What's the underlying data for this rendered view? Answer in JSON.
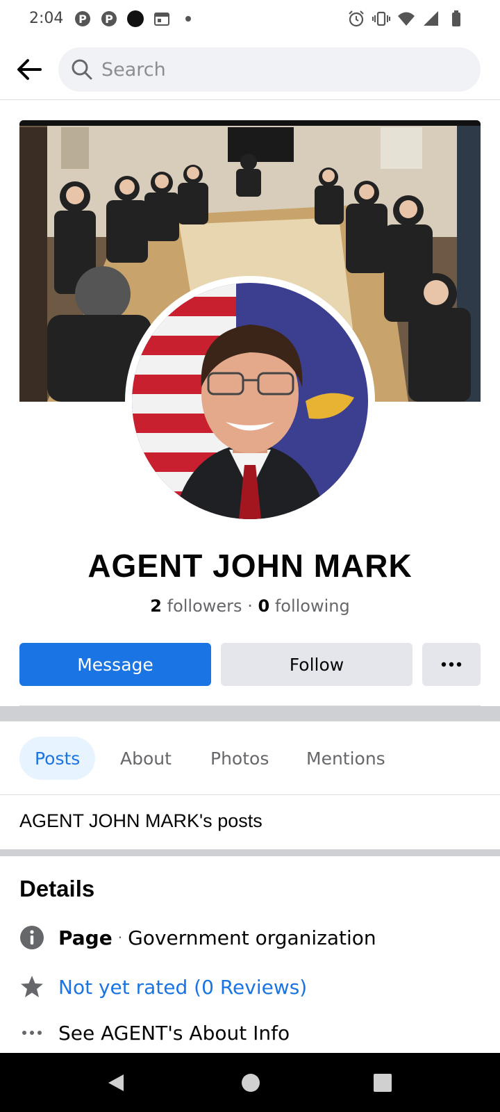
{
  "status_bar": {
    "time": "2:04",
    "left_icons": [
      "pinterest-icon",
      "pinterest-icon",
      "app-icon",
      "calendar-icon",
      "dot-icon"
    ],
    "right_icons": [
      "alarm-icon",
      "vibrate-icon",
      "wifi-icon",
      "signal-icon",
      "battery-icon"
    ]
  },
  "header": {
    "back_icon": "arrow-left-icon",
    "search_placeholder": "Search"
  },
  "profile": {
    "name": "AGENT JOHN MARK",
    "followers_count": "2",
    "followers_label": "followers",
    "separator": "·",
    "following_count": "0",
    "following_label": "following"
  },
  "actions": {
    "message_label": "Message",
    "follow_label": "Follow",
    "more_label": "•••"
  },
  "tabs": [
    {
      "label": "Posts",
      "active": true
    },
    {
      "label": "About",
      "active": false
    },
    {
      "label": "Photos",
      "active": false
    },
    {
      "label": "Mentions",
      "active": false
    }
  ],
  "posts_section": {
    "title": "AGENT JOHN MARK's posts"
  },
  "details": {
    "title": "Details",
    "page_label": "Page",
    "page_separator": "·",
    "page_category": "Government organization",
    "rating_text": "Not yet rated (0 Reviews)",
    "about_link": "See AGENT's About Info"
  },
  "colors": {
    "accent": "#1b74e4",
    "button_gray": "#e4e6eb",
    "tab_active_bg": "#e7f3ff"
  }
}
